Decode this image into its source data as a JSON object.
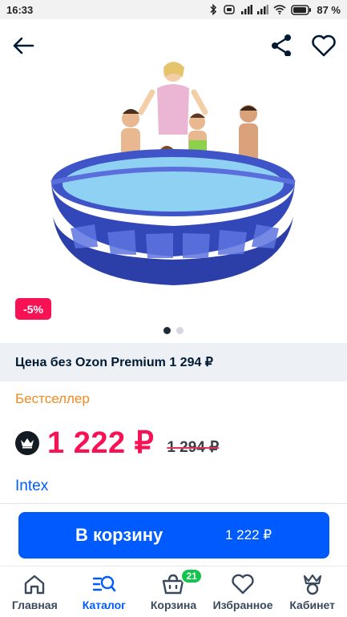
{
  "status_bar": {
    "time": "16:33",
    "battery": "87 %"
  },
  "product": {
    "discount_badge": "-5%",
    "image_dots": 2,
    "active_dot": 1,
    "premium_price_text": "Цена без Ozon Premium 1 294 ₽",
    "bestseller_label": "Бестселлер",
    "price": "1 222 ₽",
    "old_price": "1 294 ₽",
    "brand": "Intex"
  },
  "cart": {
    "button_label": "В корзину",
    "button_price": "1 222 ₽"
  },
  "tabbar": {
    "items": [
      {
        "label": "Главная",
        "icon": "home-icon",
        "active": false
      },
      {
        "label": "Каталог",
        "icon": "catalog-search-icon",
        "active": true
      },
      {
        "label": "Корзина",
        "icon": "cart-icon",
        "active": false,
        "badge": "21"
      },
      {
        "label": "Избранное",
        "icon": "heart-icon",
        "active": false
      },
      {
        "label": "Кабинет",
        "icon": "cabinet-crown-icon",
        "active": false
      }
    ]
  },
  "colors": {
    "accent": "#005bff",
    "price": "#f91155",
    "bestseller": "#f28a1e",
    "badge": "#10c44c"
  }
}
